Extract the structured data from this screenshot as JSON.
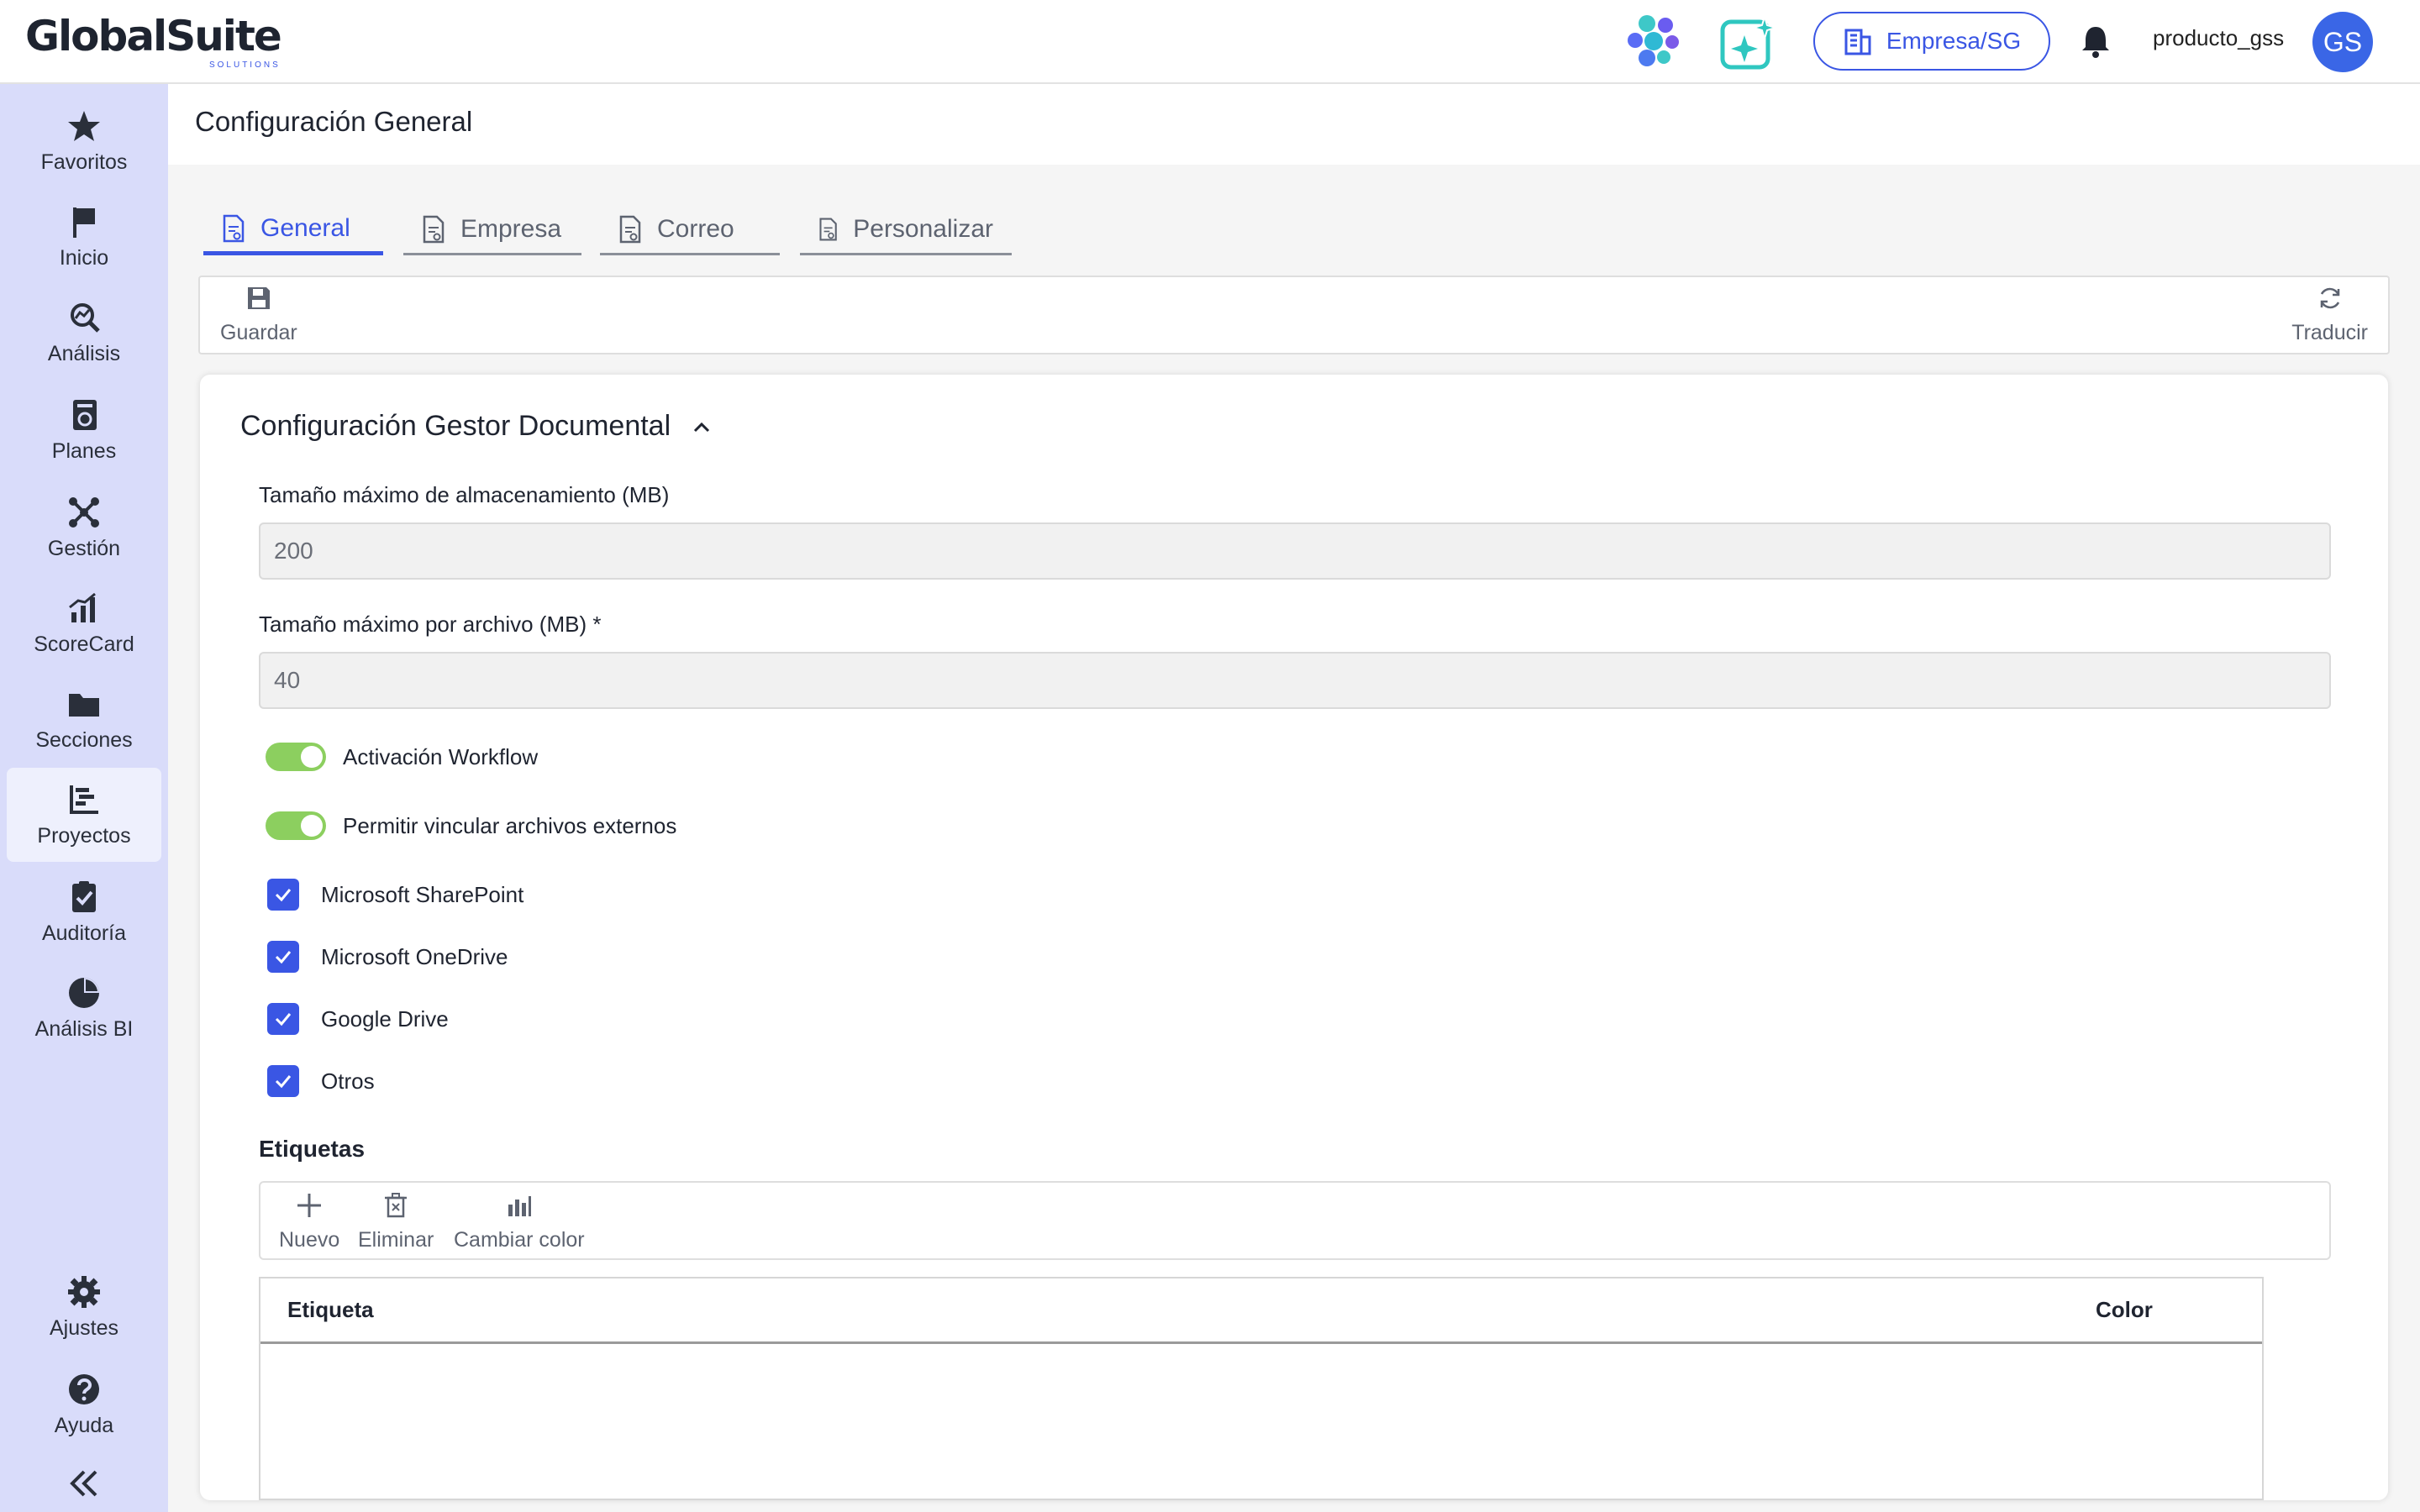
{
  "header": {
    "logo_text": "GlobalSuite",
    "logo_sub": "SOLUTIONS",
    "company": "Empresa/SG",
    "username": "producto_gss",
    "avatar_initials": "GS"
  },
  "sidebar": {
    "items": [
      {
        "label": "Favoritos",
        "icon": "star-icon"
      },
      {
        "label": "Inicio",
        "icon": "flag-icon"
      },
      {
        "label": "Análisis",
        "icon": "analysis-icon"
      },
      {
        "label": "Planes",
        "icon": "plans-icon"
      },
      {
        "label": "Gestión",
        "icon": "network-icon"
      },
      {
        "label": "ScoreCard",
        "icon": "bar-chart-icon"
      },
      {
        "label": "Secciones",
        "icon": "folder-icon"
      },
      {
        "label": "Proyectos",
        "icon": "gantt-icon"
      },
      {
        "label": "Auditoría",
        "icon": "clipboard-check-icon"
      },
      {
        "label": "Análisis BI",
        "icon": "pie-chart-icon"
      }
    ],
    "bottom": {
      "settings": "Ajustes",
      "help": "Ayuda"
    },
    "active_index": 7
  },
  "page": {
    "title": "Configuración General"
  },
  "tabs": [
    {
      "label": "General",
      "active": true
    },
    {
      "label": "Empresa",
      "active": false
    },
    {
      "label": "Correo",
      "active": false
    },
    {
      "label": "Personalizar",
      "active": false
    }
  ],
  "toolbar": {
    "save": "Guardar",
    "translate": "Traducir"
  },
  "section": {
    "title": "Configuración Gestor Documental",
    "max_storage": {
      "label": "Tamaño máximo de almacenamiento (MB)",
      "value": "200"
    },
    "max_file": {
      "label": "Tamaño máximo por archivo (MB) *",
      "value": "40"
    },
    "workflow": {
      "label": "Activación Workflow",
      "enabled": true
    },
    "external_links": {
      "label": "Permitir vincular archivos externos",
      "enabled": true
    },
    "providers": [
      {
        "label": "Microsoft SharePoint",
        "checked": true
      },
      {
        "label": "Microsoft OneDrive",
        "checked": true
      },
      {
        "label": "Google Drive",
        "checked": true
      },
      {
        "label": "Otros",
        "checked": true
      }
    ]
  },
  "tags": {
    "title": "Etiquetas",
    "actions": {
      "new": "Nuevo",
      "delete": "Eliminar",
      "color": "Cambiar color"
    },
    "columns": [
      "Etiqueta",
      "Color"
    ],
    "rows": []
  },
  "colors": {
    "accent": "#3a56e4",
    "sidebar_bg": "#d9dcfa",
    "toggle_on": "#8ccf5f"
  }
}
